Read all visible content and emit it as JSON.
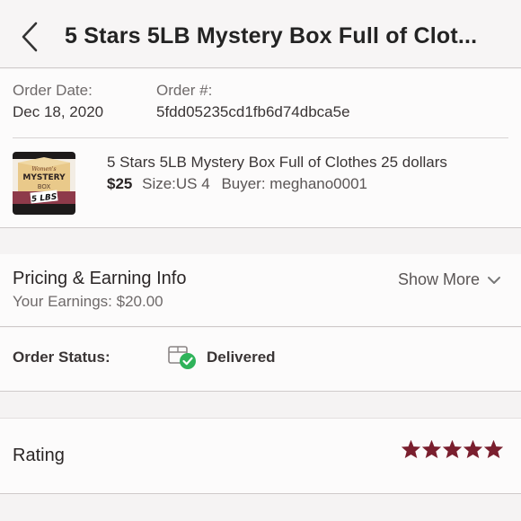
{
  "header": {
    "title": "5 Stars 5LB Mystery Box Full of Clot...",
    "back_icon": "chevron-left-icon"
  },
  "order": {
    "date_label": "Order Date:",
    "date_value": "Dec 18, 2020",
    "number_label": "Order #:",
    "number_value": "5fdd05235cd1fb6d74dbca5e"
  },
  "item": {
    "thumbnail_text": [
      "Women's",
      "MYSTERY",
      "BOX",
      "5 LBS"
    ],
    "title": "5 Stars 5LB Mystery Box Full of Clothes 25 dollars",
    "price": "$25",
    "size": "Size:US 4",
    "buyer": "Buyer: meghano0001"
  },
  "pricing": {
    "title": "Pricing & Earning Info",
    "earnings": "Your Earnings: $20.00",
    "show_more": "Show More"
  },
  "status": {
    "label": "Order Status:",
    "value": "Delivered",
    "icon": "delivered-box-check-icon"
  },
  "rating": {
    "label": "Rating",
    "stars": 5,
    "max_stars": 5,
    "star_color": "#7a1f2e"
  },
  "colors": {
    "accent": "#7a1f2e",
    "status_green": "#2fb35a"
  }
}
